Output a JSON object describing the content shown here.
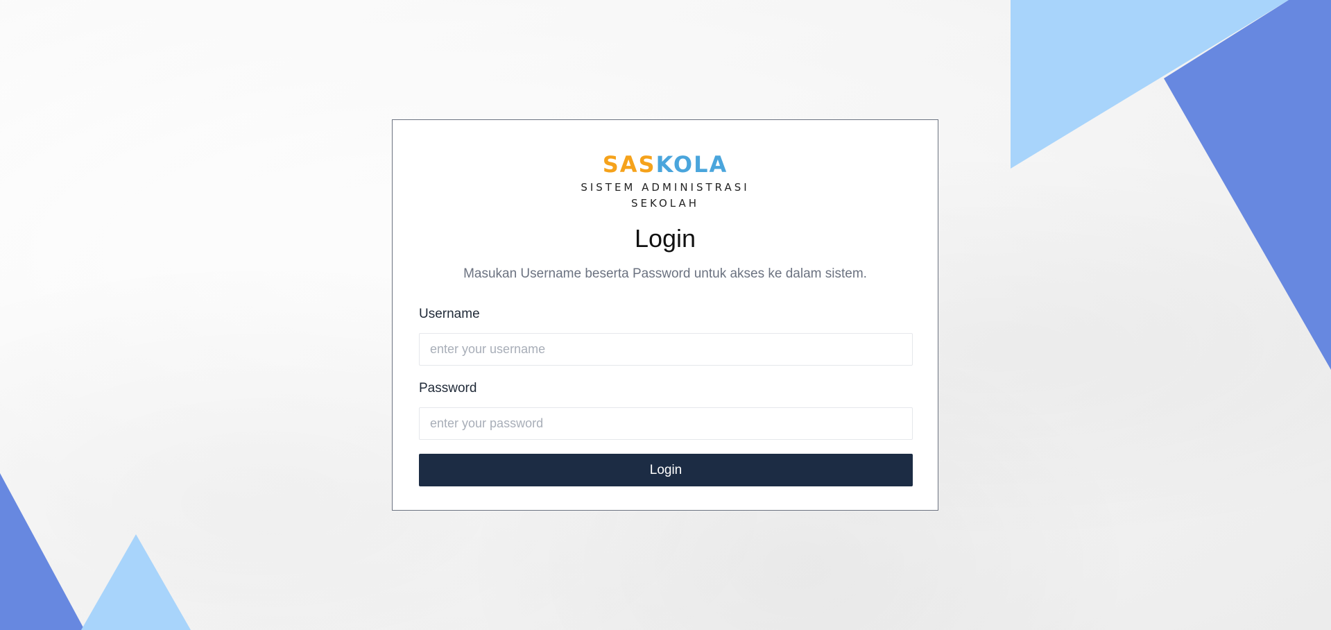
{
  "logo": {
    "part1": "SAS",
    "part2": "KOLA",
    "tagline": "SISTEM ADMINISTRASI SEKOLAH",
    "colors": {
      "part1": "#f5a21b",
      "part2": "#4aa5dc"
    }
  },
  "title": "Login",
  "subtitle": "Masukan Username beserta Password untuk akses ke dalam sistem.",
  "form": {
    "username": {
      "label": "Username",
      "placeholder": "enter your username",
      "value": ""
    },
    "password": {
      "label": "Password",
      "placeholder": "enter your password",
      "value": ""
    },
    "submit_label": "Login"
  },
  "theme": {
    "button_bg": "#1c2c44",
    "deco_light_blue": "#a8d4fb",
    "deco_dark_blue": "#6788e0"
  }
}
